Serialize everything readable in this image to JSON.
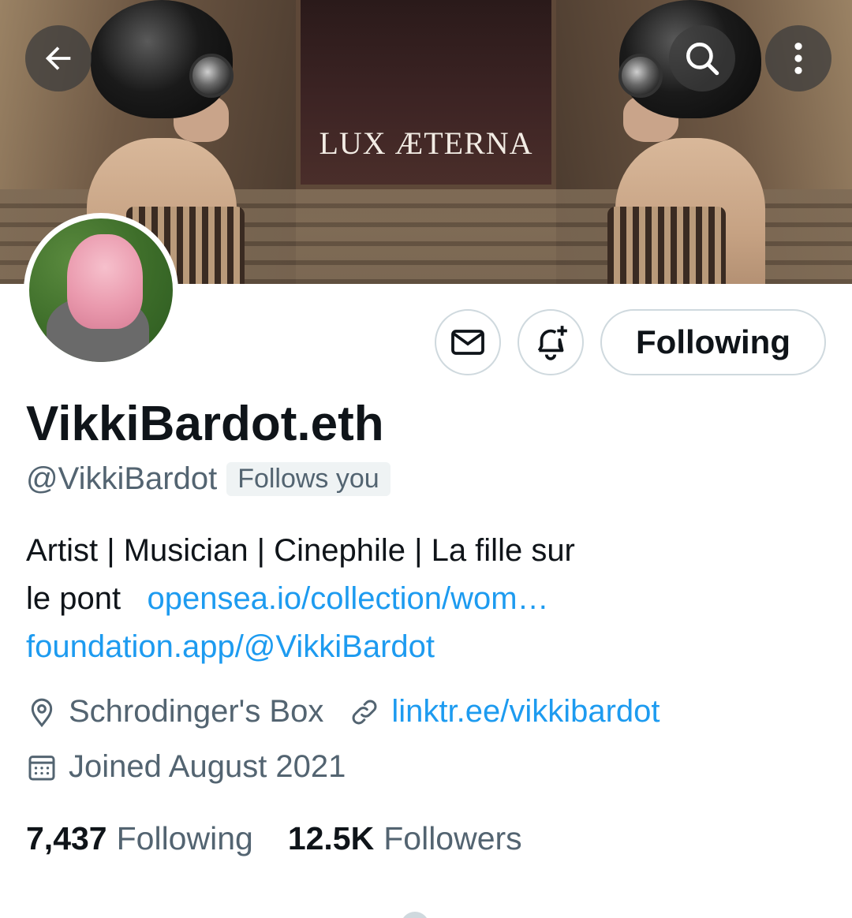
{
  "banner": {
    "title": "LUX ÆTERNA"
  },
  "topbar": {
    "back_icon": "arrow-left-icon",
    "search_icon": "search-icon",
    "more_icon": "more-vertical-icon"
  },
  "actions": {
    "message_icon": "mail-icon",
    "notify_icon": "bell-plus-icon",
    "following_label": "Following"
  },
  "profile": {
    "display_name": "VikkiBardot.eth",
    "handle": "@VikkiBardot",
    "follows_you": "Follows you",
    "bio_text_1": "Artist | Musician | Cinephile | La fille sur",
    "bio_text_2": "le pont",
    "bio_link_1": "opensea.io/collection/wom…",
    "bio_link_2": "foundation.app/@VikkiBardot",
    "location": "Schrodinger's Box",
    "website": "linktr.ee/vikkibardot",
    "joined": "Joined August 2021"
  },
  "stats": {
    "following_count": "7,437",
    "following_label": "Following",
    "followers_count": "12.5K",
    "followers_label": "Followers"
  },
  "colors": {
    "link": "#1d9bf0",
    "secondary_text": "#536471",
    "primary_text": "#0f1419",
    "border": "#cfd9de"
  }
}
